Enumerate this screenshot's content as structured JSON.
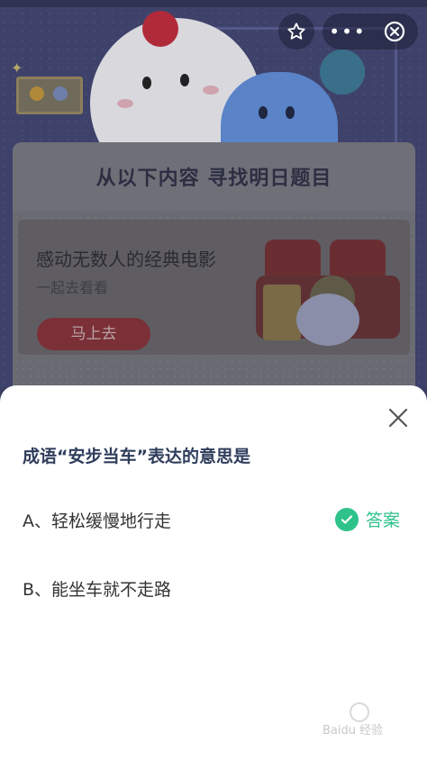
{
  "top_bar": {
    "more_label": "•••",
    "icons": [
      "star-icon",
      "more-icon",
      "close-circle-icon"
    ]
  },
  "card": {
    "title": "从以下内容 寻找明日题目",
    "promo": {
      "title": "感动无数人的经典电影",
      "subtitle": "一起去看看",
      "button_label": "马上去"
    }
  },
  "sheet": {
    "question": "成语“安步当车”表达的意思是",
    "options": [
      {
        "label": "A、轻松缓慢地行走",
        "is_answer": true
      },
      {
        "label": "B、能坐车就不走路",
        "is_answer": false
      }
    ],
    "answer_label": "答案",
    "accent_color": "#2fc28b"
  },
  "watermark": {
    "text": "Baidu 经验"
  }
}
